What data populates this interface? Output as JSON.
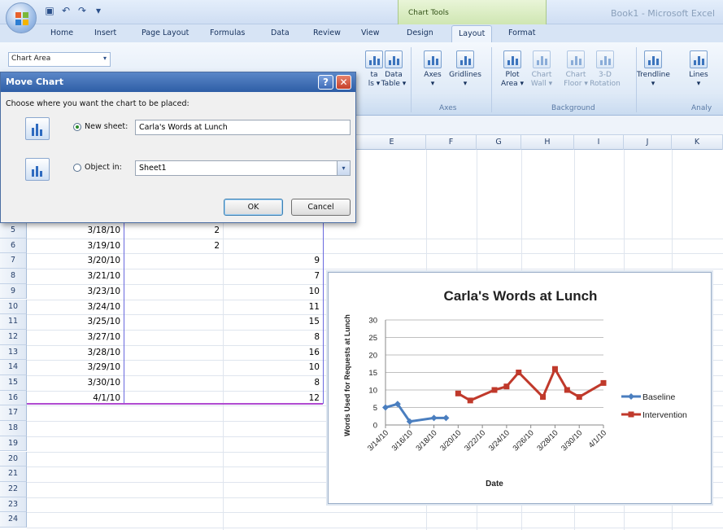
{
  "window": {
    "app_title": "Book1 - Microsoft Excel",
    "context_group": "Chart Tools"
  },
  "tabs": [
    "Home",
    "Insert",
    "Page Layout",
    "Formulas",
    "Data",
    "Review",
    "View",
    "Design",
    "Layout",
    "Format"
  ],
  "active_tab": "Layout",
  "ribbon": {
    "chart_element_selector": "Chart Area",
    "buttons": [
      {
        "label": "Data Labels",
        "partial": "ta\nls ▾"
      },
      {
        "label": "Data Table ▾",
        "partial": "Data\nTable ▾"
      },
      {
        "label": "Axes ▾",
        "partial": "Axes\n▾"
      },
      {
        "label": "Gridlines ▾",
        "partial": "Gridlines\n▾"
      },
      {
        "label": "Plot Area ▾",
        "partial": "Plot\nArea ▾"
      },
      {
        "label": "Chart Wall ▾",
        "partial": "Chart\nWall ▾"
      },
      {
        "label": "Chart Floor ▾",
        "partial": "Chart\nFloor ▾"
      },
      {
        "label": "3-D Rotation",
        "partial": "3-D\nRotation"
      },
      {
        "label": "Trendline ▾",
        "partial": "Trendline\n▾"
      },
      {
        "label": "Lines",
        "partial": "Lines\n▾"
      }
    ],
    "groups": [
      "Axes",
      "Background",
      "Analy"
    ]
  },
  "spreadsheet": {
    "columns": [
      "E",
      "F",
      "G",
      "H",
      "I",
      "J",
      "K"
    ],
    "rows": [
      {
        "num": "5",
        "a": "3/18/10",
        "b": "2",
        "c": ""
      },
      {
        "num": "6",
        "a": "3/19/10",
        "b": "2",
        "c": ""
      },
      {
        "num": "7",
        "a": "3/20/10",
        "b": "",
        "c": "9"
      },
      {
        "num": "8",
        "a": "3/21/10",
        "b": "",
        "c": "7"
      },
      {
        "num": "9",
        "a": "3/23/10",
        "b": "",
        "c": "10"
      },
      {
        "num": "10",
        "a": "3/24/10",
        "b": "",
        "c": "11"
      },
      {
        "num": "11",
        "a": "3/25/10",
        "b": "",
        "c": "15"
      },
      {
        "num": "12",
        "a": "3/27/10",
        "b": "",
        "c": "8"
      },
      {
        "num": "13",
        "a": "3/28/10",
        "b": "",
        "c": "16"
      },
      {
        "num": "14",
        "a": "3/29/10",
        "b": "",
        "c": "10"
      },
      {
        "num": "15",
        "a": "3/30/10",
        "b": "",
        "c": "8"
      },
      {
        "num": "16",
        "a": "4/1/10",
        "b": "",
        "c": "12"
      },
      {
        "num": "17",
        "a": "",
        "b": "",
        "c": ""
      },
      {
        "num": "18",
        "a": "",
        "b": "",
        "c": ""
      },
      {
        "num": "19",
        "a": "",
        "b": "",
        "c": ""
      },
      {
        "num": "20",
        "a": "",
        "b": "",
        "c": ""
      },
      {
        "num": "21",
        "a": "",
        "b": "",
        "c": ""
      },
      {
        "num": "22",
        "a": "",
        "b": "",
        "c": ""
      },
      {
        "num": "23",
        "a": "",
        "b": "",
        "c": ""
      },
      {
        "num": "24",
        "a": "",
        "b": "",
        "c": ""
      }
    ]
  },
  "dialog": {
    "title": "Move Chart",
    "prompt": "Choose where you want the chart to be placed:",
    "option_new_sheet_label": "New sheet:",
    "option_new_sheet_value": "Carla's Words at Lunch",
    "option_object_in_label": "Object in:",
    "option_object_in_value": "Sheet1",
    "selected_option": "new_sheet",
    "ok_label": "OK",
    "cancel_label": "Cancel",
    "help_glyph": "?",
    "close_glyph": "✕"
  },
  "colors": {
    "baseline": "#4a7ebf",
    "intervention": "#c0392b",
    "title_bar": "#2e5ea6"
  },
  "chart_data": {
    "type": "line",
    "title": "Carla's Words at Lunch",
    "xlabel": "Date",
    "ylabel": "Words Used for Requests at Lunch",
    "ylim": [
      0,
      30
    ],
    "yticks": [
      0,
      5,
      10,
      15,
      20,
      25,
      30
    ],
    "x_tick_labels": [
      "3/14/10",
      "3/16/10",
      "3/18/10",
      "3/20/10",
      "3/22/10",
      "3/24/10",
      "3/26/10",
      "3/28/10",
      "3/30/10",
      "4/1/10"
    ],
    "x_range_dates": [
      "3/14/10",
      "4/1/10"
    ],
    "grid": "horizontal",
    "legend_position": "right",
    "series": [
      {
        "name": "Baseline",
        "color": "#4a7ebf",
        "marker": "diamond",
        "x": [
          "3/14/10",
          "3/15/10",
          "3/16/10",
          "3/18/10",
          "3/19/10"
        ],
        "values": [
          5,
          6,
          1,
          2,
          2
        ]
      },
      {
        "name": "Intervention",
        "color": "#c0392b",
        "marker": "square",
        "x": [
          "3/20/10",
          "3/21/10",
          "3/23/10",
          "3/24/10",
          "3/25/10",
          "3/27/10",
          "3/28/10",
          "3/29/10",
          "3/30/10",
          "4/1/10"
        ],
        "values": [
          9,
          7,
          10,
          11,
          15,
          8,
          16,
          10,
          8,
          12
        ]
      }
    ]
  }
}
